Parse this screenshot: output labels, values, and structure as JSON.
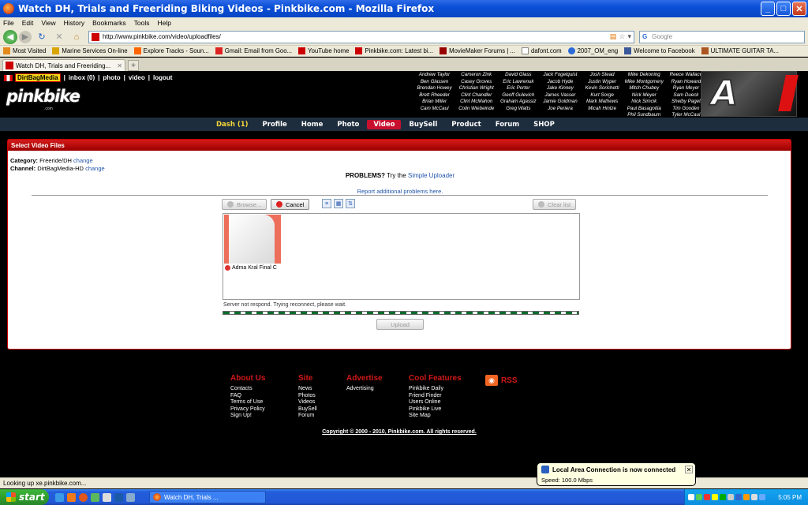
{
  "window": {
    "title": "Watch DH, Trials and Freeriding Biking Videos - Pinkbike.com - Mozilla Firefox"
  },
  "menu": [
    "File",
    "Edit",
    "View",
    "History",
    "Bookmarks",
    "Tools",
    "Help"
  ],
  "address": {
    "url": "http://www.pinkbike.com/video/uploadfiles/",
    "search_placeholder": "Google"
  },
  "bookmarks": [
    "Most Visited",
    "Marine Services On-line",
    "Explore Tracks - Soun...",
    "Gmail: Email from Goo...",
    "YouTube home",
    "Pinkbike.com: Latest bi...",
    "MovieMaker Forums | ...",
    "dafont.com",
    "2007_OM_eng",
    "Welcome to Facebook",
    "ULTIMATE GUITAR TA..."
  ],
  "tab": {
    "label": "Watch DH, Trials and Freeriding...",
    "new_tab": "+"
  },
  "site": {
    "username": "DirtBagMedia",
    "user_links": [
      "inbox (0)",
      "photo",
      "video",
      "logout"
    ],
    "logo": "pinkbike",
    "logo_sub": ".com",
    "riders": [
      [
        "Andrew Taylor",
        "Ben Glassen",
        "Brendan Howey",
        "Brett Rheeder",
        "Brian Miller",
        "Cam McCaul"
      ],
      [
        "Cameron Zink",
        "Casey Groves",
        "Christian Wright",
        "Clint Chandler",
        "Clint McMahon",
        "Colin Wiebeinde"
      ],
      [
        "David Glass",
        "Eric Lawrenuk",
        "Eric Porter",
        "Geoff Gulevich",
        "Graham Agassiz",
        "Greg Watts"
      ],
      [
        "Jack Fogelquist",
        "Jacob Hyde",
        "Jake Kinney",
        "James Vasser",
        "Jamie Goldman",
        "Joe Periera"
      ],
      [
        "Josh Stead",
        "Justin Wyper",
        "Kevin Sorichetti",
        "Kurt Sorge",
        "Mark Mathews",
        "Micah Hintze"
      ],
      [
        "Mike Dekoning",
        "Mike Montgomery",
        "Mitch Chubey",
        "Nick Meyer",
        "Nick Simcik",
        "Paul Basagoitia",
        "Phil Sundbaum"
      ],
      [
        "Reece Wallace",
        "Ryan Howard",
        "Ryan Meyer",
        "Sam Dueck",
        "Shelby Paget",
        "Tim Gooden",
        "Tyler McCaul"
      ]
    ],
    "nav": [
      "Dash (1)",
      "Profile",
      "Home",
      "Photo",
      "Video",
      "BuySell",
      "Product",
      "Forum",
      "SHOP"
    ],
    "nav_active": "Video"
  },
  "upload": {
    "panel_title": "Select Video Files",
    "category_label": "Category:",
    "category_value": "Freeride/DH",
    "channel_label": "Channel:",
    "channel_value": "DirtBagMedia-HD",
    "change": "change",
    "problems": "PROBLEMS?",
    "try": "Try the",
    "simple_uploader": "Simple Uploader",
    "report": "Report additional problems here.",
    "browse": "Browse...",
    "cancel": "Cancel",
    "clear_list": "Clear list",
    "file_name": "Adma Kral Final C",
    "status": "Server not respond. Trying reconnect, please wait.",
    "upload": "Upload"
  },
  "footer": {
    "about": {
      "title": "About Us",
      "items": [
        "Contacts",
        "FAQ",
        "Terms of Use",
        "Privacy Policy",
        "Sign Up!"
      ]
    },
    "site": {
      "title": "Site",
      "items": [
        "News",
        "Photos",
        "Videos",
        "BuySell",
        "Forum"
      ]
    },
    "advertise": {
      "title": "Advertise",
      "items": [
        "Advertising"
      ]
    },
    "cool": {
      "title": "Cool Features",
      "items": [
        "Pinkbike Daily",
        "Friend Finder",
        "Users Online",
        "Pinkbike Live",
        "Site Map"
      ]
    },
    "rss": "RSS",
    "copyright": "Copyright © 2000 - 2010, Pinkbike.com. All rights reserved."
  },
  "statusbar": "Looking up xe.pinkbike.com...",
  "balloon": {
    "title": "Local Area Connection is now connected",
    "speed": "Speed: 100.0 Mbps"
  },
  "taskbar": {
    "start": "start",
    "task": "Watch DH, Trials ...",
    "clock": "5:05 PM"
  },
  "colors": {
    "brand_red": "#c8102e",
    "nav_bg": "#1e2d3d",
    "xp_blue": "#245edb",
    "progress_green": "#0a6b2b"
  }
}
